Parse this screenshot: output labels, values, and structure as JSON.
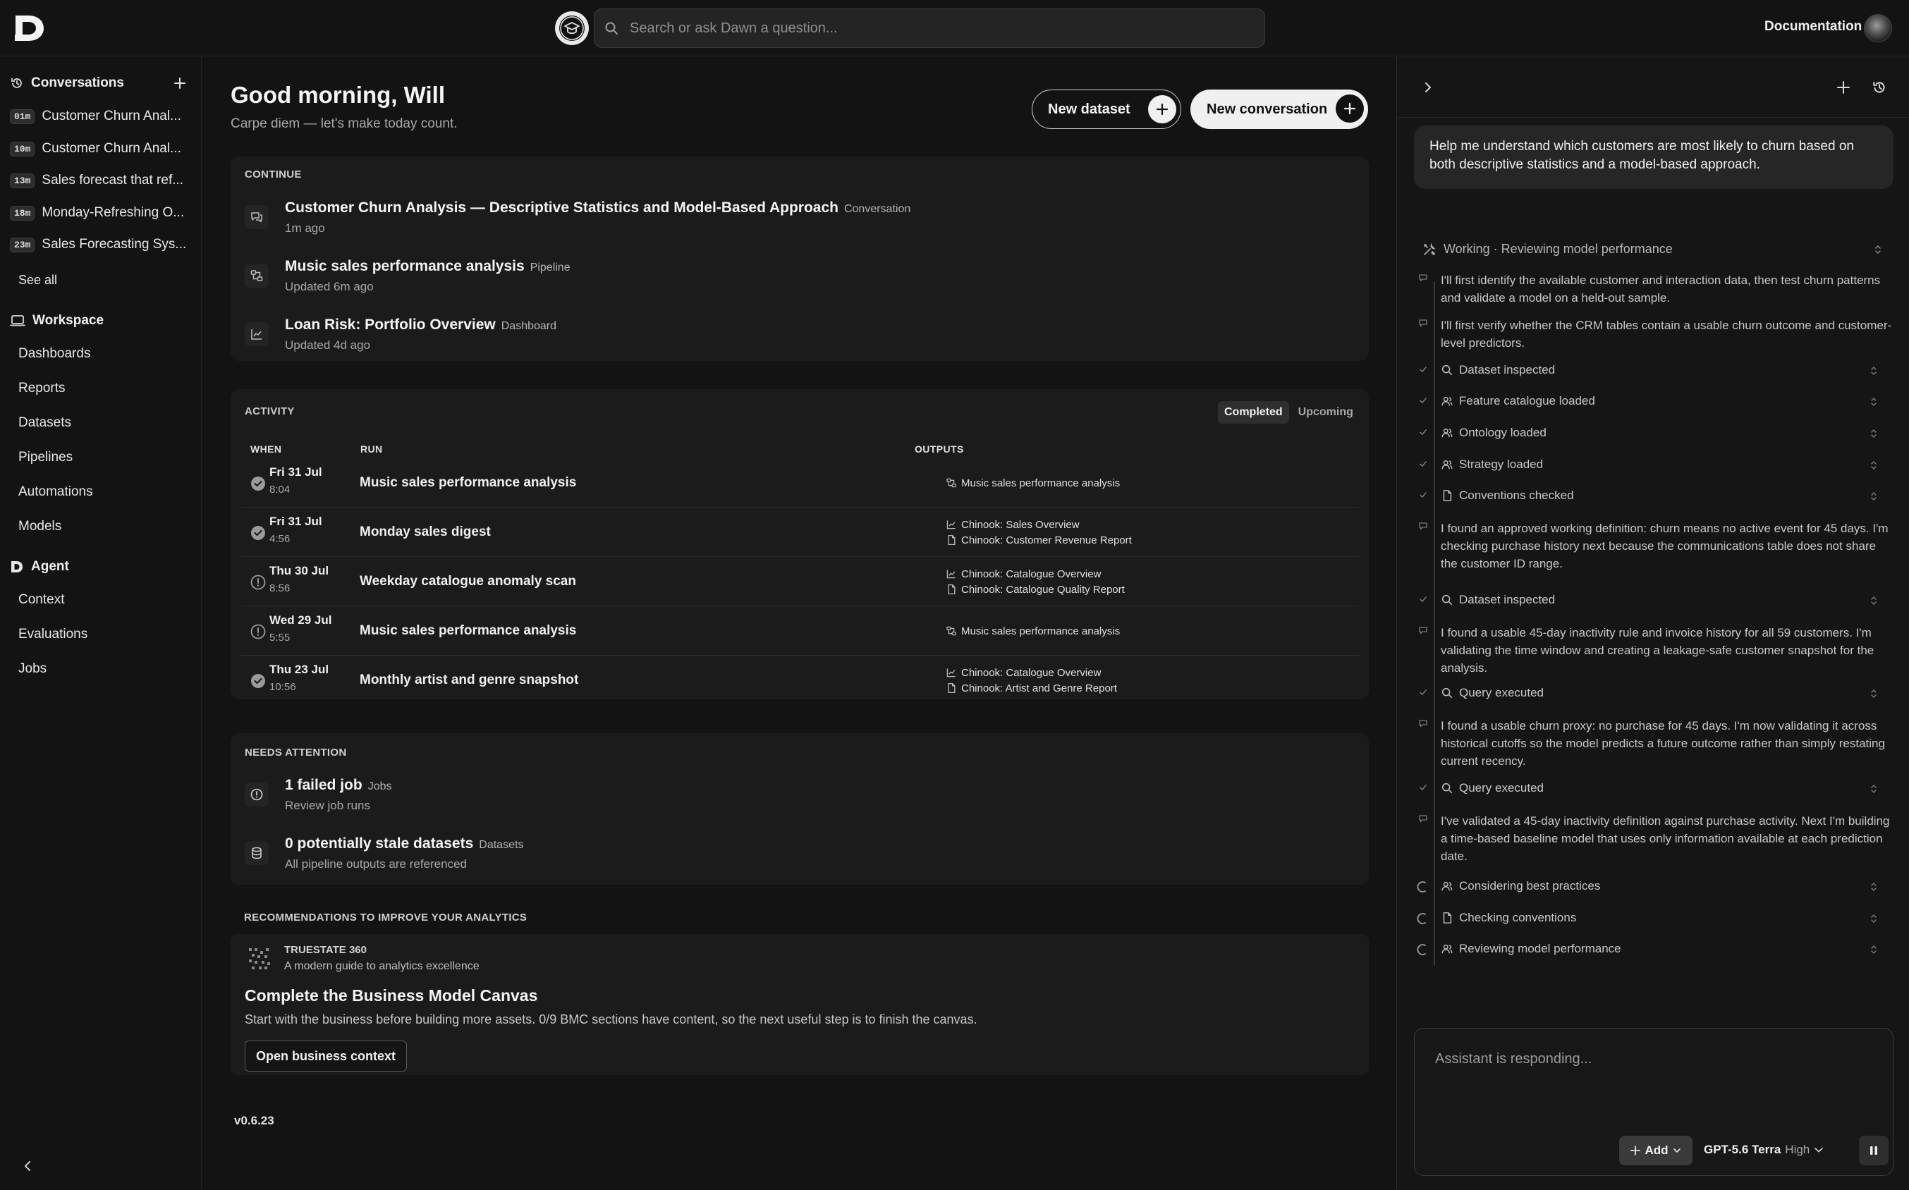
{
  "header": {
    "search_placeholder": "Search or ask Dawn a question...",
    "documentation": "Documentation"
  },
  "sidebar": {
    "conversations_title": "Conversations",
    "conversations": [
      {
        "age": "01m",
        "title": "Customer Churn Anal..."
      },
      {
        "age": "10m",
        "title": "Customer Churn Anal..."
      },
      {
        "age": "13m",
        "title": "Sales forecast that ref..."
      },
      {
        "age": "18m",
        "title": "Monday-Refreshing O..."
      },
      {
        "age": "23m",
        "title": "Sales Forecasting Sys..."
      }
    ],
    "see_all": "See all",
    "workspace_title": "Workspace",
    "workspace_items": [
      "Dashboards",
      "Reports",
      "Datasets",
      "Pipelines",
      "Automations",
      "Models"
    ],
    "agent_title": "Agent",
    "agent_items": [
      "Context",
      "Evaluations",
      "Jobs"
    ]
  },
  "main": {
    "greeting": "Good morning, Will",
    "subtitle": "Carpe diem — let's make today count.",
    "new_dataset": "New dataset",
    "new_conversation": "New conversation",
    "continue_label": "CONTINUE",
    "continue_items": [
      {
        "title": "Customer Churn Analysis — Descriptive Statistics and Model-Based Approach",
        "type": "Conversation",
        "sub": "1m ago",
        "icon": "chat-icon"
      },
      {
        "title": "Music sales performance analysis",
        "type": "Pipeline",
        "sub": "Updated 6m ago",
        "icon": "pipeline-icon"
      },
      {
        "title": "Loan Risk: Portfolio Overview",
        "type": "Dashboard",
        "sub": "Updated 4d ago",
        "icon": "chart-line-icon"
      }
    ],
    "activity_label": "ACTIVITY",
    "activity_tabs": [
      "Completed",
      "Upcoming"
    ],
    "activity_columns": [
      "WHEN",
      "RUN",
      "OUTPUTS"
    ],
    "activity_rows": [
      {
        "status": "completed",
        "day": "Fri 31 Jul",
        "time": "8:04",
        "run": "Music sales performance analysis",
        "outputs": [
          {
            "icon": "pipeline-icon",
            "label": "Music sales performance analysis"
          }
        ]
      },
      {
        "status": "completed",
        "day": "Fri 31 Jul",
        "time": "4:56",
        "run": "Monday sales digest",
        "outputs": [
          {
            "icon": "chart-line-icon",
            "label": "Chinook: Sales Overview"
          },
          {
            "icon": "document-icon",
            "label": "Chinook: Customer Revenue Report"
          }
        ]
      },
      {
        "status": "warning",
        "day": "Thu 30 Jul",
        "time": "8:56",
        "run": "Weekday catalogue anomaly scan",
        "outputs": [
          {
            "icon": "chart-line-icon",
            "label": "Chinook: Catalogue Overview"
          },
          {
            "icon": "document-icon",
            "label": "Chinook: Catalogue Quality Report"
          }
        ]
      },
      {
        "status": "warning",
        "day": "Wed 29 Jul",
        "time": "5:55",
        "run": "Music sales performance analysis",
        "outputs": [
          {
            "icon": "pipeline-icon",
            "label": "Music sales performance analysis"
          }
        ]
      },
      {
        "status": "completed",
        "day": "Thu 23 Jul",
        "time": "10:56",
        "run": "Monthly artist and genre snapshot",
        "outputs": [
          {
            "icon": "chart-line-icon",
            "label": "Chinook: Catalogue Overview"
          },
          {
            "icon": "document-icon",
            "label": "Chinook: Artist and Genre Report"
          }
        ]
      }
    ],
    "attention_label": "NEEDS ATTENTION",
    "attention_items": [
      {
        "title": "1 failed job",
        "type": "Jobs",
        "sub": "Review job runs",
        "icon": "alert-icon"
      },
      {
        "title": "0 potentially stale datasets",
        "type": "Datasets",
        "sub": "All pipeline outputs are referenced",
        "icon": "database-icon"
      }
    ],
    "recommend_label": "RECOMMENDATIONS TO IMPROVE YOUR ANALYTICS",
    "recommendation": {
      "source": "TRUESTATE 360",
      "source_desc": "A modern guide to analytics excellence",
      "title": "Complete the Business Model Canvas",
      "body": "Start with the business before building more assets. 0/9 BMC sections have content, so the next useful step is to finish the canvas.",
      "button": "Open business context"
    },
    "version": "v0.6.23"
  },
  "assistant": {
    "user_message": "Help me understand which customers are most likely to churn based on both descriptive statistics and a model-based approach.",
    "working_status": "Working · Reviewing model performance",
    "steps": [
      {
        "kind": "text",
        "node": "chat",
        "text": "I'll first identify the available customer and interaction data, then test churn patterns and validate a model on a held-out sample."
      },
      {
        "kind": "text",
        "node": "chat",
        "text": "I'll first verify whether the CRM tables contain a usable churn outcome and customer-level predictors."
      },
      {
        "kind": "tool",
        "node": "check",
        "icon": "search-icon",
        "text": "Dataset inspected"
      },
      {
        "kind": "tool",
        "node": "check",
        "icon": "people-icon",
        "text": "Feature catalogue loaded"
      },
      {
        "kind": "tool",
        "node": "check",
        "icon": "people-icon",
        "text": "Ontology loaded"
      },
      {
        "kind": "tool",
        "node": "check",
        "icon": "people-icon",
        "text": "Strategy loaded"
      },
      {
        "kind": "tool",
        "node": "check",
        "icon": "document-icon",
        "text": "Conventions checked"
      },
      {
        "kind": "text",
        "node": "chat",
        "text": "I found an approved working definition: churn means no active event for 45 days. I'm checking purchase history next because the communications table does not share the customer ID range."
      },
      {
        "kind": "tool",
        "node": "check",
        "icon": "search-icon",
        "text": "Dataset inspected"
      },
      {
        "kind": "text",
        "node": "chat",
        "text": "I found a usable 45-day inactivity rule and invoice history for all 59 customers. I'm validating the time window and creating a leakage-safe customer snapshot for the analysis."
      },
      {
        "kind": "tool",
        "node": "check",
        "icon": "search-icon",
        "text": "Query executed"
      },
      {
        "kind": "text",
        "node": "chat",
        "text": "I found a usable churn proxy: no purchase for 45 days. I'm now validating it across historical cutoffs so the model predicts a future outcome rather than simply restating current recency."
      },
      {
        "kind": "tool",
        "node": "check",
        "icon": "search-icon",
        "text": "Query executed"
      },
      {
        "kind": "text",
        "node": "chat",
        "text": "I've validated a 45-day inactivity definition against purchase activity. Next I'm building a time-based baseline model that uses only information available at each prediction date."
      },
      {
        "kind": "tool",
        "node": "spin",
        "icon": "people-icon",
        "text": "Considering best practices"
      },
      {
        "kind": "tool",
        "node": "spin",
        "icon": "document-icon",
        "text": "Checking conventions"
      },
      {
        "kind": "tool",
        "node": "spin",
        "icon": "people-icon",
        "text": "Reviewing model performance"
      }
    ],
    "composer_placeholder": "Assistant is responding...",
    "add_label": "Add",
    "model_name": "GPT-5.6 Terra",
    "model_level": "High"
  }
}
